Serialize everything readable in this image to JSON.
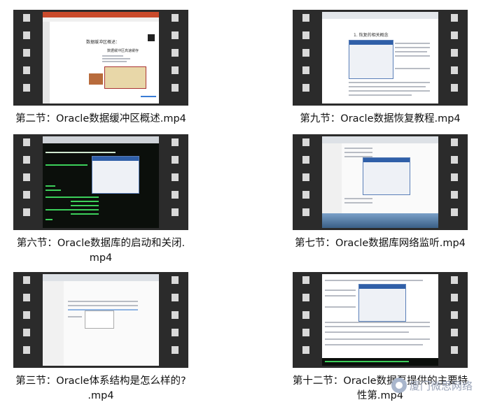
{
  "videos": [
    {
      "title_lines": [
        "第二节：Oracle数据缓冲区概述.mp4"
      ],
      "slide_title": "数据缓冲区概述：",
      "slide_subtitle": "数据缓冲区高速缓存"
    },
    {
      "title_lines": [
        "第九节：Oracle数据恢复教程.mp4"
      ],
      "doc_heading": "1. 恢复的相关概念"
    },
    {
      "title_lines": [
        "第六节：Oracle数据库的启动和关闭.",
        "mp4"
      ]
    },
    {
      "title_lines": [
        "第七节：Oracle数据库网络监听.mp4"
      ]
    },
    {
      "title_lines": [
        "第三节：Oracle体系结构是怎么样的?",
        ".mp4"
      ]
    },
    {
      "title_lines": [
        "第十二节：Oracle数据泵提供的主要特",
        "性第.mp4"
      ]
    }
  ],
  "watermark": {
    "text": "厦门微思网络",
    "icon": "wechat-logo-icon"
  },
  "colors": {
    "film": "#2b2b2b",
    "perforation": "#d9d9d9",
    "caption": "#111111"
  }
}
